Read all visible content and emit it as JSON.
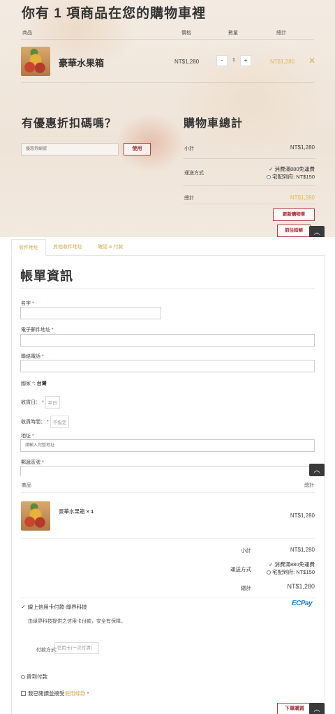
{
  "cart": {
    "title": "你有 1 項商品在您的購物車裡",
    "headers": {
      "product": "商品",
      "price": "價格",
      "quantity": "數量",
      "total": "總計"
    },
    "item": {
      "name": "豪華水果箱",
      "price": "NT$1,280",
      "quantity": "1",
      "line_total": "NT$1,280"
    },
    "qty_minus": "-",
    "qty_plus": "+",
    "remove_glyph": "✕"
  },
  "coupon": {
    "title": "有優惠折扣碼嗎？",
    "placeholder": "優惠券編號",
    "apply_label": "使用"
  },
  "totals": {
    "title": "購物車總計",
    "subtotal_label": "小計",
    "subtotal_value": "NT$1,280",
    "shipping_label": "運送方式",
    "shipping_option_1": "消費滿880免運費",
    "shipping_option_2": "宅配到府: NT$150",
    "total_label": "總計",
    "total_value": "NT$1,280",
    "update_cart_label": "更新購物車",
    "checkout_label": "前往結帳"
  },
  "scroll_top_glyph": "︿",
  "checkout_tabs": [
    "收件地址",
    "其他收件地址",
    "確認 & 付款"
  ],
  "billing": {
    "title": "帳單資訊",
    "required_mark": "*",
    "name_label": "名字",
    "email_label": "電子郵件地址",
    "phone_label": "聯絡電話",
    "country_label": "國家",
    "country_value": "台灣",
    "delivery_date_label": "收貨日：",
    "delivery_date_value": "平日",
    "delivery_time_label": "收貨時間：",
    "delivery_time_value": "不指定",
    "address_label": "地址",
    "address_placeholder": "請輸入完整地址",
    "postcode_label": "郵遞區號"
  },
  "order": {
    "headers": {
      "product": "商品",
      "total": "總計"
    },
    "item_name": "豪華水果箱",
    "item_qty": "× 1",
    "item_total": "NT$1,280",
    "subtotal_label": "小計",
    "subtotal_value": "NT$1,280",
    "shipping_label": "運送方式",
    "shipping_option_1": "消費滿880免運費",
    "shipping_option_2": "宅配到府: NT$150",
    "total_label": "總計",
    "total_value": "NT$1,280",
    "payment_online": "線上信用卡付款-綠界科技",
    "ecpay_logo_text": "ECPay",
    "payment_desc": "由綠界科技提供之信用卡付款，安全有保障。",
    "payment_method_label": "付款方式：",
    "payment_method_value": "信用卡(一次付清)",
    "payment_cod": "貨到付款",
    "terms_prefix": "我已閱讀並接受",
    "terms_link": "使用條款",
    "place_order_label": "下單購買"
  }
}
